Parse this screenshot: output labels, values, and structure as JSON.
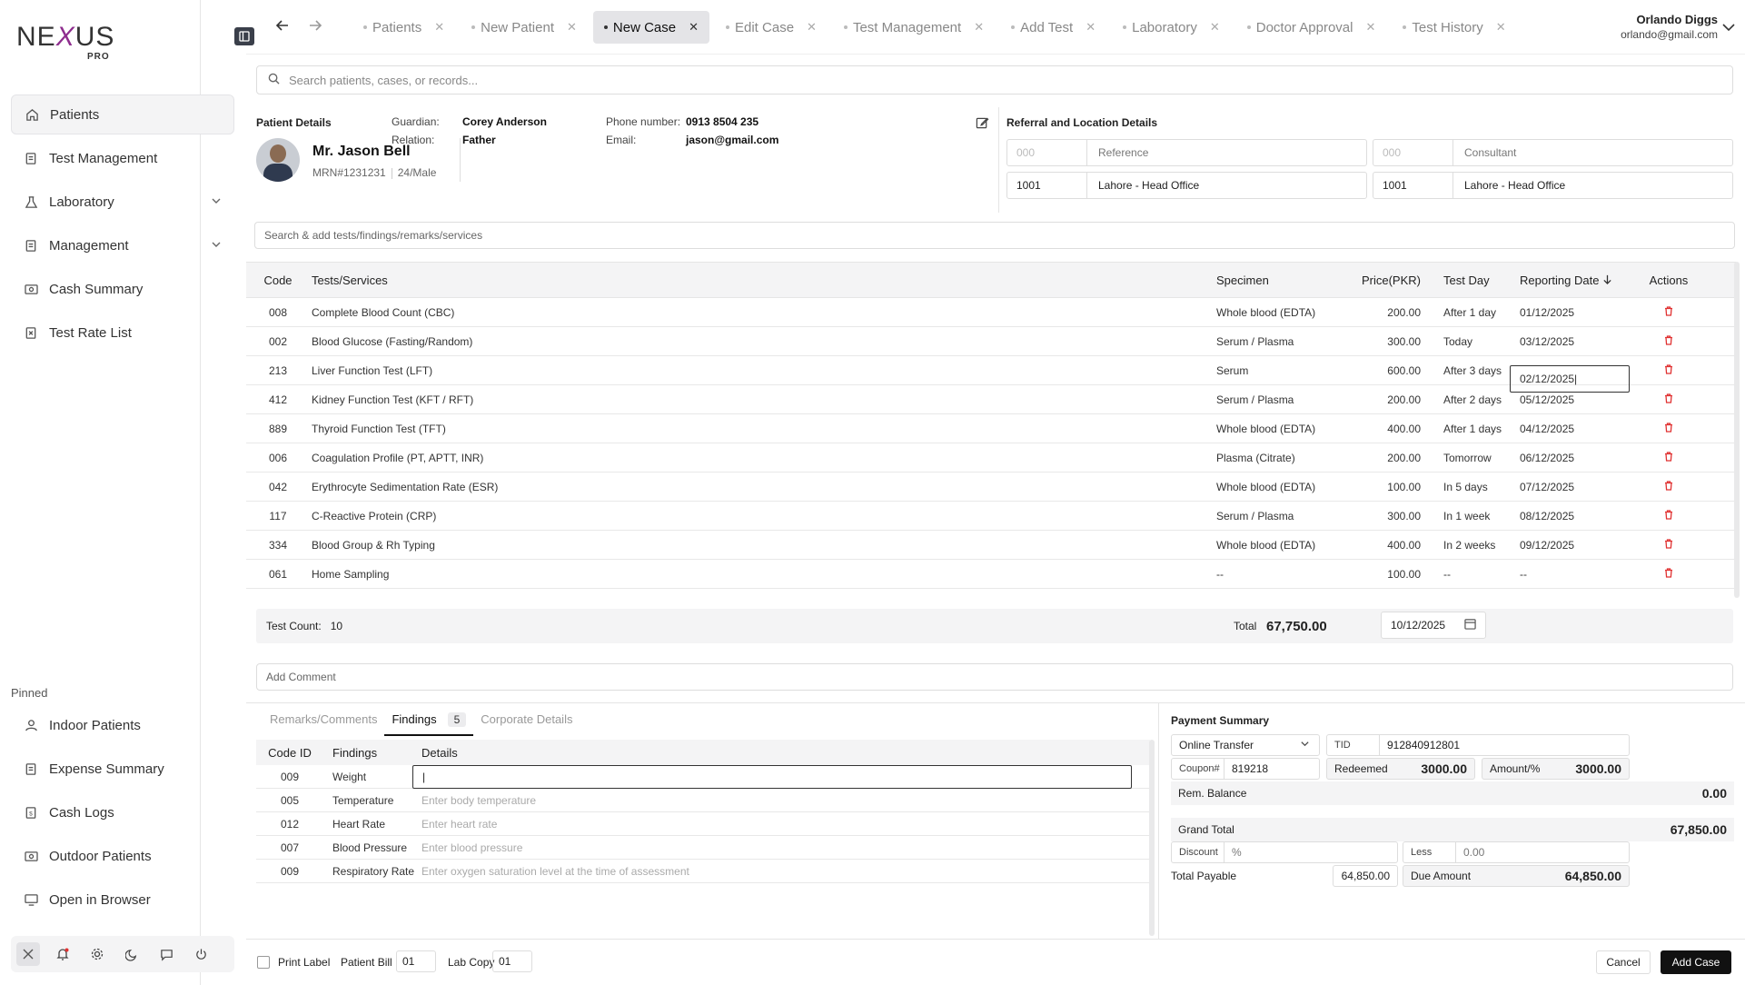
{
  "brand": {
    "word_left": "NE",
    "word_x": "X",
    "word_right": "US",
    "sub": "PRO"
  },
  "sidebar": {
    "items": [
      {
        "label": "Patients",
        "icon": "home-icon"
      },
      {
        "label": "Test Management",
        "icon": "clipboard-icon"
      },
      {
        "label": "Laboratory",
        "icon": "flask-icon"
      },
      {
        "label": "Management",
        "icon": "folder-icon"
      },
      {
        "label": "Cash Summary",
        "icon": "cash-icon"
      },
      {
        "label": "Test Rate List",
        "icon": "list-icon"
      }
    ],
    "pinned_label": "Pinned",
    "pinned": [
      {
        "label": "Indoor Patients",
        "icon": "users-icon"
      },
      {
        "label": "Expense Summary",
        "icon": "receipt-icon"
      },
      {
        "label": "Cash Logs",
        "icon": "log-icon"
      },
      {
        "label": "Outdoor Patients",
        "icon": "cash-icon"
      },
      {
        "label": "Open in Browser",
        "icon": "browser-icon"
      }
    ]
  },
  "tabs": [
    {
      "label": "Patients"
    },
    {
      "label": "New Patient"
    },
    {
      "label": "New Case"
    },
    {
      "label": "Edit Case"
    },
    {
      "label": "Test Management"
    },
    {
      "label": "Add Test"
    },
    {
      "label": "Laboratory"
    },
    {
      "label": "Doctor Approval"
    },
    {
      "label": "Test History"
    }
  ],
  "user": {
    "name": "Orlando Diggs",
    "email": "orlando@gmail.com"
  },
  "search": {
    "placeholder": "Search patients, cases, or records..."
  },
  "patient": {
    "section_title": "Patient Details",
    "name": "Mr. Jason Bell",
    "mrn": "MRN#1231231",
    "age_gender": "24/Male",
    "guardian_label": "Guardian:",
    "guardian": "Corey Anderson",
    "relation_label": "Relation:",
    "relation": "Father",
    "phone_label": "Phone number:",
    "phone": "0913 8504 235",
    "email_label": "Email:",
    "email": "jason@gmail.com"
  },
  "referral": {
    "section_title": "Referral and Location Details",
    "ref_code_ph": "000",
    "ref_name_ph": "Reference",
    "cons_code_ph": "000",
    "cons_name_ph": "Consultant",
    "loc1_code": "1001",
    "loc1_name": "Lahore - Head Office",
    "loc2_code": "1001",
    "loc2_name": "Lahore - Head Office"
  },
  "add_tests": {
    "placeholder": "Search & add tests/findings/remarks/services"
  },
  "tests": {
    "headers": {
      "code": "Code",
      "name": "Tests/Services",
      "specimen": "Specimen",
      "price": "Price(PKR)",
      "day": "Test Day",
      "date": "Reporting Date",
      "actions": "Actions"
    },
    "rows": [
      {
        "code": "008",
        "name": "Complete Blood Count (CBC)",
        "specimen": "Whole blood (EDTA)",
        "price": "200.00",
        "day": "After 1 day",
        "date": "01/12/2025"
      },
      {
        "code": "002",
        "name": "Blood Glucose (Fasting/Random)",
        "specimen": "Serum / Plasma",
        "price": "300.00",
        "day": "Today",
        "date": "03/12/2025"
      },
      {
        "code": "213",
        "name": "Liver Function Test (LFT)",
        "specimen": "Serum",
        "price": "600.00",
        "day": "After 3 days",
        "date": "02/12/2025|"
      },
      {
        "code": "412",
        "name": "Kidney Function Test (KFT / RFT)",
        "specimen": "Serum / Plasma",
        "price": "200.00",
        "day": "After 2 days",
        "date": "05/12/2025"
      },
      {
        "code": "889",
        "name": "Thyroid Function Test (TFT)",
        "specimen": "Whole blood (EDTA)",
        "price": "400.00",
        "day": "After 1 days",
        "date": "04/12/2025"
      },
      {
        "code": "006",
        "name": "Coagulation Profile (PT, APTT, INR)",
        "specimen": "Plasma (Citrate)",
        "price": "200.00",
        "day": "Tomorrow",
        "date": "06/12/2025"
      },
      {
        "code": "042",
        "name": " Erythrocyte Sedimentation Rate (ESR)",
        "specimen": "Whole blood (EDTA)",
        "price": "100.00",
        "day": "In 5 days",
        "date": "07/12/2025"
      },
      {
        "code": "117",
        "name": "C-Reactive Protein (CRP)",
        "specimen": "Serum / Plasma",
        "price": "300.00",
        "day": "In 1 week",
        "date": "08/12/2025"
      },
      {
        "code": "334",
        "name": "Blood Group & Rh Typing",
        "specimen": "Whole blood (EDTA)",
        "price": "400.00",
        "day": "In 2 weeks",
        "date": "09/12/2025"
      },
      {
        "code": "061",
        "name": "Home Sampling",
        "specimen": "--",
        "price": "100.00",
        "day": "--",
        "date": "--"
      }
    ]
  },
  "totals": {
    "count_label": "Test Count:",
    "count": "10",
    "total_label": "Total",
    "total": "67,750.00",
    "date": "10/12/2025"
  },
  "comment": {
    "placeholder": "Add Comment"
  },
  "findings": {
    "tabs": {
      "remarks": "Remarks/Comments",
      "findings": "Findings",
      "count": "5",
      "corporate": "Corporate Details"
    },
    "headers": {
      "code": "Code ID",
      "finding": "Findings",
      "details": "Details"
    },
    "rows": [
      {
        "code": "009",
        "finding": "Weight",
        "details": "|"
      },
      {
        "code": "005",
        "finding": "Temperature",
        "details": "Enter body temperature"
      },
      {
        "code": "012",
        "finding": "Heart Rate",
        "details": "Enter heart rate"
      },
      {
        "code": "007",
        "finding": "Blood Pressure",
        "details": "Enter blood pressure"
      },
      {
        "code": "009",
        "finding": "Respiratory Rate",
        "details": "Enter oxygen saturation level at the time of assessment"
      }
    ]
  },
  "payment": {
    "title": "Payment Summary",
    "method": "Online Transfer",
    "tid_label": "TID",
    "tid": "912840912801",
    "coupon_label": "Coupon#",
    "coupon": "819218",
    "redeemed_label": "Redeemed",
    "redeemed": "3000.00",
    "amount_label": "Amount/%",
    "amount": "3000.00",
    "rem_label": "Rem. Balance",
    "rem": "0.00",
    "grand_label": "Grand Total",
    "grand": "67,850.00",
    "discount_label": "Discount",
    "discount_ph": "%",
    "less_label": "Less",
    "less": "0.00",
    "payable_label": "Total Payable",
    "payable": "64,850.00",
    "due_label": "Due Amount",
    "due": "64,850.00"
  },
  "footer": {
    "print_label": "Print Label",
    "bill_label": "Patient Bill",
    "bill_copies": "01",
    "lab_label": "Lab Copy",
    "lab_copies": "01",
    "cancel": "Cancel",
    "add": "Add Case"
  }
}
